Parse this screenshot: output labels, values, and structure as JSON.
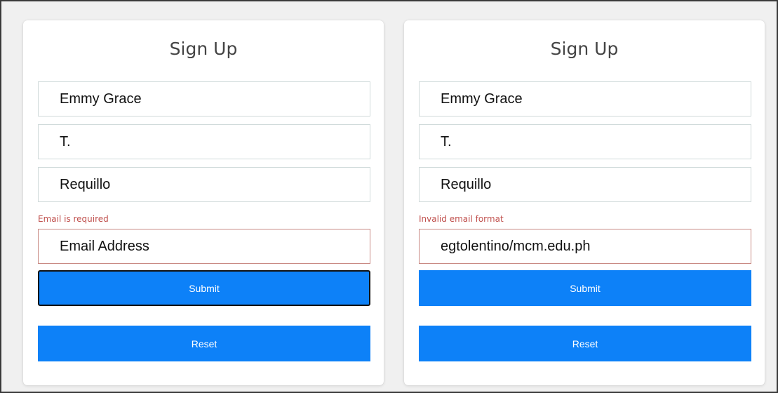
{
  "forms": [
    {
      "title": "Sign Up",
      "first_name_value": "Emmy Grace",
      "middle_initial_value": "T.",
      "last_name_value": "Requillo",
      "email_error": "Email is required",
      "email_text": "Email Address",
      "submit_label": "Submit",
      "reset_label": "Reset"
    },
    {
      "title": "Sign Up",
      "first_name_value": "Emmy Grace",
      "middle_initial_value": "T.",
      "last_name_value": "Requillo",
      "email_error": "Invalid email format",
      "email_text": "egtolentino/mcm.edu.ph",
      "submit_label": "Submit",
      "reset_label": "Reset"
    }
  ],
  "colors": {
    "button": "#0d81f8",
    "error_text": "#c0504d",
    "error_border": "#c98a84",
    "field_border": "#d0dada"
  }
}
